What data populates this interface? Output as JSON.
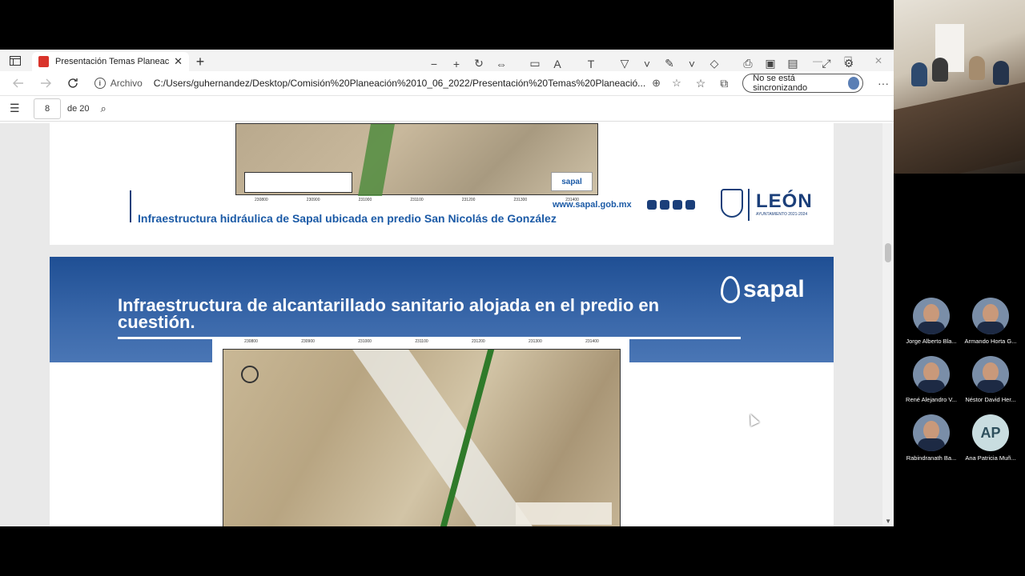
{
  "browser": {
    "tab_title": "Presentación Temas Planeación.p",
    "tab_close": "✕",
    "new_tab": "+",
    "win_minimize": "—",
    "win_restore": "❐",
    "win_close": "✕",
    "url_prefix": "Archivo",
    "url": "C:/Users/guhernandez/Desktop/Comisión%20Planeación%2010_06_2022/Presentación%20Temas%20Planeació...",
    "sync_label": "No se está sincronizando",
    "more_label": "···"
  },
  "pdf_toolbar": {
    "page_current": "8",
    "page_total": "de 20"
  },
  "slide_prev": {
    "caption": "Infraestructura hidráulica de Sapal ubicada en predio San Nicolás de  González",
    "website": "www.sapal.gob.mx",
    "map_logo": "sapal",
    "leon_title": "LEÓN",
    "leon_sub": "AYUNTAMIENTO 2021-2024",
    "map_ticks": [
      "230800",
      "230900",
      "231000",
      "231100",
      "231200",
      "231300",
      "231400"
    ]
  },
  "slide_current": {
    "title": "Infraestructura de alcantarillado sanitario alojada en el predio en cuestión.",
    "logo_text": "sapal",
    "map_ticks": [
      "230800",
      "230900",
      "231000",
      "231100",
      "231200",
      "231300",
      "231400"
    ]
  },
  "participants": [
    {
      "name": "Jorge Alberto Bla...",
      "initials": ""
    },
    {
      "name": "Armando Horta G...",
      "initials": ""
    },
    {
      "name": "René Alejandro V...",
      "initials": ""
    },
    {
      "name": "Néstor David Her...",
      "initials": ""
    },
    {
      "name": "Rabindranath Ba...",
      "initials": ""
    },
    {
      "name": "Ana Patricia Muñ...",
      "initials": "AP"
    }
  ],
  "colors": {
    "brand_blue": "#1b3f7a",
    "header_blue": "#1f4f94",
    "caption_blue": "#1b5aa6",
    "pdf_red": "#d9342b"
  }
}
